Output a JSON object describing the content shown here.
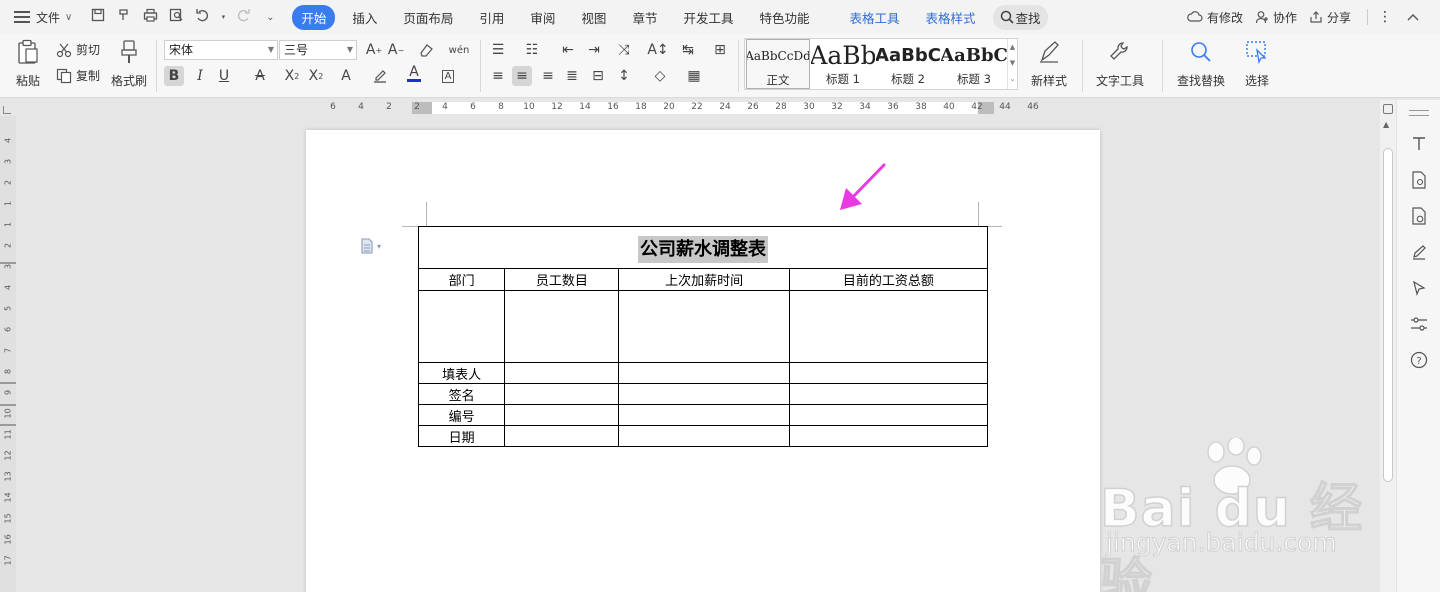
{
  "menubar": {
    "file_label": "文件",
    "tabs": [
      {
        "label": "开始"
      },
      {
        "label": "插入"
      },
      {
        "label": "页面布局"
      },
      {
        "label": "引用"
      },
      {
        "label": "审阅"
      },
      {
        "label": "视图"
      },
      {
        "label": "章节"
      },
      {
        "label": "开发工具"
      },
      {
        "label": "特色功能"
      },
      {
        "label": "表格工具"
      },
      {
        "label": "表格样式"
      },
      {
        "label": "查找"
      }
    ],
    "right": {
      "changes": "有修改",
      "collab": "协作",
      "share": "分享"
    }
  },
  "ribbon": {
    "paste": "粘贴",
    "cut": "剪切",
    "copy": "复制",
    "format_painter": "格式刷",
    "font_name": "宋体",
    "font_size": "三号",
    "styles": [
      {
        "preview": "AaBbCcDd",
        "label": "正文"
      },
      {
        "preview": "AaBb",
        "label": "标题 1"
      },
      {
        "preview": "AaBbC",
        "label": "标题 2"
      },
      {
        "preview": "AaBbC",
        "label": "标题 3"
      }
    ],
    "new_style": "新样式",
    "text_tools": "文字工具",
    "find_replace": "查找替换",
    "select": "选择"
  },
  "ruler": {
    "h_ticks": [
      "6",
      "4",
      "2",
      "2",
      "4",
      "6",
      "8",
      "10",
      "12",
      "14",
      "16",
      "18",
      "20",
      "22",
      "24",
      "26",
      "28",
      "30",
      "32",
      "34",
      "36",
      "38",
      "40",
      "42",
      "44",
      "46"
    ],
    "v_ticks": [
      "4",
      "3",
      "2",
      "1",
      "1",
      "2",
      "3",
      "4",
      "5",
      "6",
      "7",
      "8",
      "9",
      "10",
      "11",
      "12",
      "13",
      "14",
      "15",
      "16",
      "17"
    ]
  },
  "document": {
    "title": "公司薪水调整表",
    "headers": [
      "部门",
      "员工数目",
      "上次加薪时间",
      "目前的工资总额"
    ],
    "rows": [
      "填表人",
      "签名",
      "编号",
      "日期"
    ]
  },
  "watermark": {
    "brand": "Bai du 经验",
    "url": "jingyan.baidu.com"
  },
  "colors": {
    "accent": "#3a7cf0",
    "table_tool_tabs": "#2f6fd6",
    "arrow": "#e83ae0",
    "selection": "#c8c8c8"
  }
}
